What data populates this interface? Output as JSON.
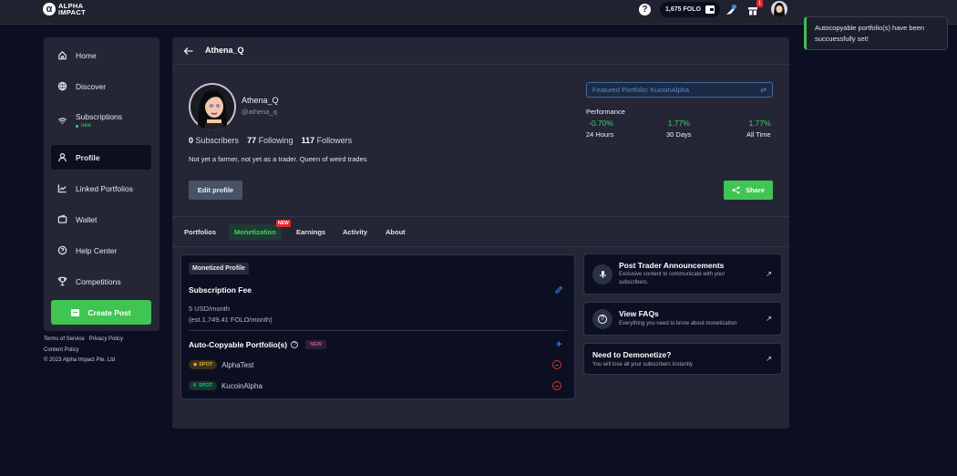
{
  "topbar": {
    "logo_line1": "ALPHA",
    "logo_line2": "IMPACT",
    "logo_mark": "α",
    "help_icon": "?",
    "balance": "1,675 FOLO",
    "notification_badge": "1"
  },
  "toast": {
    "message": "Autocopyable portfolio(s) have been succuessfully set!",
    "accent": "#3fbf4f"
  },
  "sidebar": {
    "items": [
      {
        "label": "Home",
        "icon": "home-icon"
      },
      {
        "label": "Discover",
        "icon": "globe-icon"
      },
      {
        "label": "Subscriptions",
        "icon": "wifi-icon",
        "sub": "new"
      },
      {
        "label": "Profile",
        "icon": "user-icon",
        "active": true
      },
      {
        "label": "Linked Portfolios",
        "icon": "chart-icon"
      },
      {
        "label": "Wallet",
        "icon": "wallet-icon"
      },
      {
        "label": "Help Center",
        "icon": "help-icon"
      },
      {
        "label": "Competitions",
        "icon": "trophy-icon"
      }
    ],
    "create_post": "Create Post",
    "footer": {
      "terms": "Terms of Service",
      "privacy": "Privacy Policy",
      "content": "Content Policy",
      "copyright": "© 2023 Alpha Impact Pte. Ltd"
    }
  },
  "profile": {
    "header_title": "Athena_Q",
    "name": "Athena_Q",
    "handle": "@athena_q",
    "subscribers_count": "0",
    "subscribers_label": "Subscribers",
    "following_count": "77",
    "following_label": "Following",
    "followers_count": "117",
    "followers_label": "Followers",
    "bio": "Not yet a farmer, not yet as a trader. Queen of weird trades",
    "edit_button": "Edit profile",
    "share_button": "Share",
    "featured_portfolio": "Featured Portfolio: KucoinAlpha",
    "performance_label": "Performance",
    "performance": [
      {
        "value": "-0.70%",
        "period": "24 Hours"
      },
      {
        "value": "1.77%",
        "period": "30 Days"
      },
      {
        "value": "1.77%",
        "period": "All Time"
      }
    ]
  },
  "tabs": [
    {
      "label": "Portfolios"
    },
    {
      "label": "Monetization",
      "active": true,
      "badge": "NEW"
    },
    {
      "label": "Earnings"
    },
    {
      "label": "Activity"
    },
    {
      "label": "About"
    }
  ],
  "monetization": {
    "tag": "Monetized Profile",
    "subscription_title": "Subscription Fee",
    "fee_usd": "5 USD/month",
    "fee_folo": "(est.1,749.41 FOLO/month)",
    "auto_title": "Auto-Copyable Portfolio(s)",
    "auto_badge": "NEW",
    "portfolios": [
      {
        "badge": "SPOT",
        "exchange": "binance",
        "name": "AlphaTest"
      },
      {
        "badge": "SPOT",
        "exchange": "kucoin",
        "name": "KucoinAlpha"
      }
    ]
  },
  "side_cards": [
    {
      "title": "Post Trader Announcements",
      "desc": "Exclusive content to communicate with your subscribers.",
      "icon": "microphone-icon"
    },
    {
      "title": "View FAQs",
      "desc": "Everything you need to know about monetization",
      "icon": "question-icon"
    },
    {
      "title": "Need to Demonetize?",
      "desc": "You will lose all your subscribers instantly"
    }
  ]
}
